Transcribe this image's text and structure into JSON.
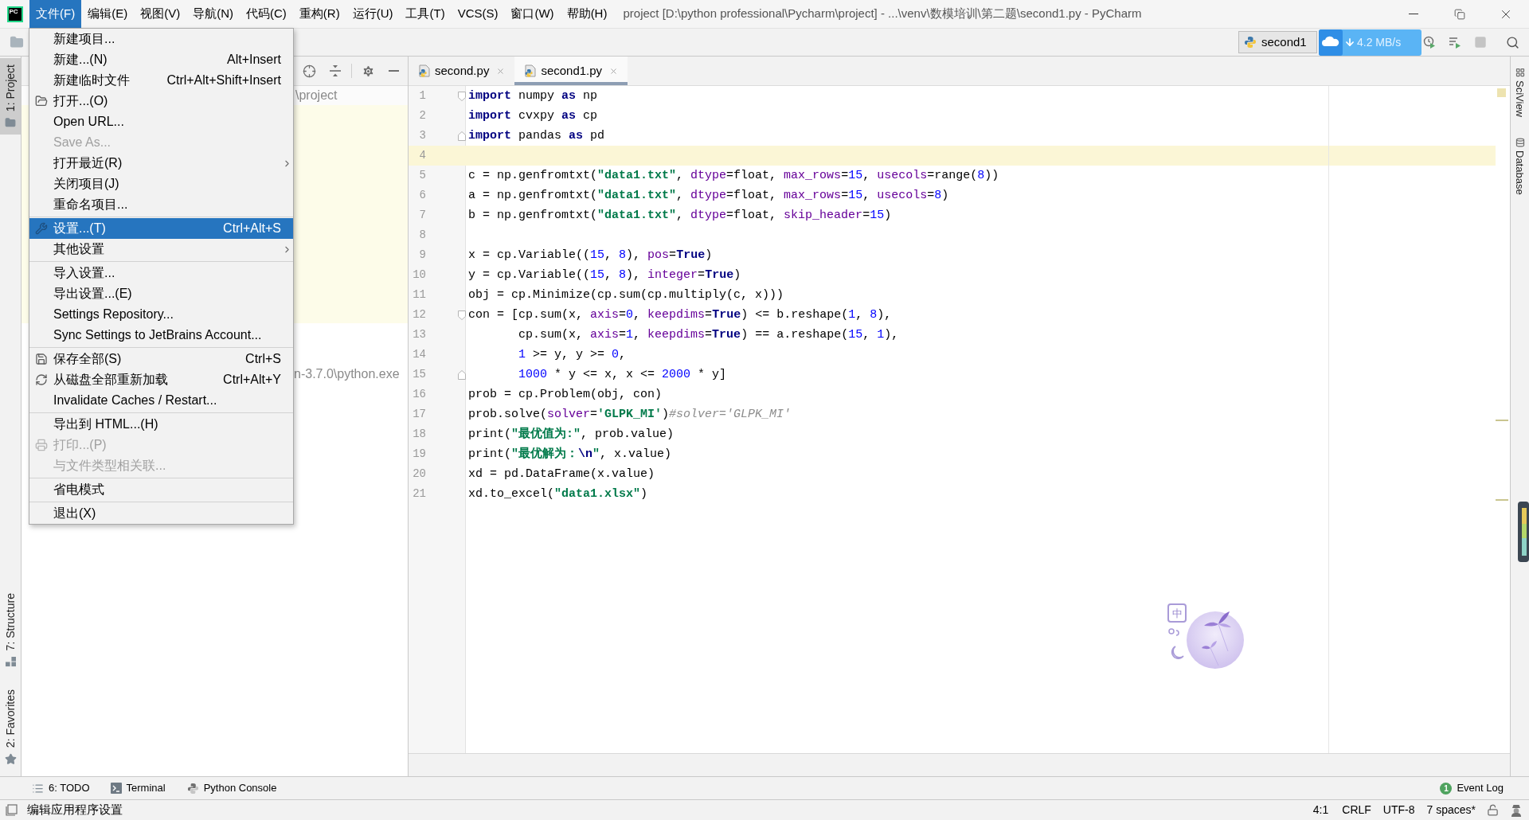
{
  "window": {
    "logo_text": "PC",
    "title": "project [D:\\python professional\\Pycharm\\project] - ...\\venv\\数模培训\\第二题\\second1.py - PyCharm"
  },
  "menu_bar": [
    {
      "label": "文件(F)",
      "selected": true
    },
    {
      "label": "编辑(E)",
      "selected": false
    },
    {
      "label": "视图(V)",
      "selected": false
    },
    {
      "label": "导航(N)",
      "selected": false
    },
    {
      "label": "代码(C)",
      "selected": false
    },
    {
      "label": "重构(R)",
      "selected": false
    },
    {
      "label": "运行(U)",
      "selected": false
    },
    {
      "label": "工具(T)",
      "selected": false
    },
    {
      "label": "VCS(S)",
      "selected": false
    },
    {
      "label": "窗口(W)",
      "selected": false
    },
    {
      "label": "帮助(H)",
      "selected": false
    }
  ],
  "file_menu": {
    "groups": [
      {
        "items": [
          {
            "label": "新建项目...",
            "submenu": false,
            "disabled": false,
            "selected": false
          },
          {
            "label": "新建...(N)",
            "shortcut": "Alt+Insert",
            "submenu": false,
            "disabled": false,
            "selected": false
          },
          {
            "label": "新建临时文件",
            "shortcut": "Ctrl+Alt+Shift+Insert",
            "submenu": false,
            "disabled": false,
            "selected": false
          },
          {
            "label": "打开...(O)",
            "submenu": false,
            "disabled": false,
            "selected": false
          },
          {
            "label": "Open URL...",
            "submenu": false,
            "disabled": false,
            "selected": false
          },
          {
            "label": "Save As...",
            "submenu": false,
            "disabled": true,
            "selected": false
          },
          {
            "label": "打开最近(R)",
            "submenu": true,
            "disabled": false,
            "selected": false
          },
          {
            "label": "关闭项目(J)",
            "submenu": false,
            "disabled": false,
            "selected": false
          },
          {
            "label": "重命名项目...",
            "submenu": false,
            "disabled": false,
            "selected": false
          }
        ]
      },
      {
        "items": [
          {
            "label": "设置...(T)",
            "shortcut": "Ctrl+Alt+S",
            "submenu": false,
            "disabled": false,
            "selected": true
          },
          {
            "label": "其他设置",
            "submenu": true,
            "disabled": false,
            "selected": false
          }
        ]
      },
      {
        "items": [
          {
            "label": "导入设置...",
            "submenu": false,
            "disabled": false,
            "selected": false
          },
          {
            "label": "导出设置...(E)",
            "submenu": false,
            "disabled": false,
            "selected": false
          },
          {
            "label": "Settings Repository...",
            "submenu": false,
            "disabled": false,
            "selected": false
          },
          {
            "label": "Sync Settings to JetBrains Account...",
            "submenu": false,
            "disabled": false,
            "selected": false
          }
        ]
      },
      {
        "items": [
          {
            "label": "保存全部(S)",
            "shortcut": "Ctrl+S",
            "submenu": false,
            "disabled": false,
            "selected": false
          },
          {
            "label": "从磁盘全部重新加载",
            "shortcut": "Ctrl+Alt+Y",
            "submenu": false,
            "disabled": false,
            "selected": false
          },
          {
            "label": "Invalidate Caches / Restart...",
            "submenu": false,
            "disabled": false,
            "selected": false
          }
        ]
      },
      {
        "items": [
          {
            "label": "导出到 HTML...(H)",
            "submenu": false,
            "disabled": false,
            "selected": false
          },
          {
            "label": "打印...(P)",
            "submenu": false,
            "disabled": true,
            "selected": false
          },
          {
            "label": "与文件类型相关联...",
            "submenu": false,
            "disabled": true,
            "selected": false
          }
        ]
      },
      {
        "items": [
          {
            "label": "省电模式",
            "submenu": false,
            "disabled": false,
            "selected": false
          }
        ]
      },
      {
        "items": [
          {
            "label": "退出(X)",
            "submenu": false,
            "disabled": false,
            "selected": false
          }
        ]
      }
    ]
  },
  "toolbar": {
    "run_config": "second1"
  },
  "download_widget": {
    "speed": "4.2 MB/s"
  },
  "left_tool_tabs": [
    {
      "label": "1: Project",
      "selected": true
    },
    {
      "label": "7: Structure",
      "selected": false
    },
    {
      "label": "2: Favorites",
      "selected": false
    }
  ],
  "project_panel": {
    "rows": [
      "\\project",
      "n-3.7.0\\python.exe"
    ]
  },
  "editor_tabs": [
    {
      "label": "second.py",
      "selected": false
    },
    {
      "label": "second1.py",
      "selected": true
    }
  ],
  "editor": {
    "lines": [
      {
        "number": "1",
        "current": false,
        "fold_start": true,
        "fold_end": false,
        "tokens": [
          {
            "kind": "keyword",
            "text": "import"
          },
          {
            "kind": "plain",
            "text": " numpy "
          },
          {
            "kind": "keyword",
            "text": "as"
          },
          {
            "kind": "plain",
            "text": " np"
          }
        ]
      },
      {
        "number": "2",
        "current": false,
        "fold_start": false,
        "fold_end": false,
        "tokens": [
          {
            "kind": "keyword",
            "text": "import"
          },
          {
            "kind": "plain",
            "text": " cvxpy "
          },
          {
            "kind": "keyword",
            "text": "as"
          },
          {
            "kind": "plain",
            "text": " cp"
          }
        ]
      },
      {
        "number": "3",
        "current": false,
        "fold_start": false,
        "fold_end": true,
        "tokens": [
          {
            "kind": "keyword",
            "text": "import"
          },
          {
            "kind": "plain",
            "text": " pandas "
          },
          {
            "kind": "keyword",
            "text": "as"
          },
          {
            "kind": "plain",
            "text": " pd"
          }
        ]
      },
      {
        "number": "4",
        "current": true,
        "fold_start": false,
        "fold_end": false
      },
      {
        "number": "5",
        "current": false,
        "fold_start": false,
        "fold_end": false,
        "tokens": [
          {
            "kind": "plain",
            "text": "c = np.genfromtxt("
          },
          {
            "kind": "string",
            "text": "\"data1.txt\""
          },
          {
            "kind": "plain",
            "text": ", "
          },
          {
            "kind": "kwarg",
            "text": "dtype"
          },
          {
            "kind": "plain",
            "text": "=float, "
          },
          {
            "kind": "kwarg",
            "text": "max_rows"
          },
          {
            "kind": "plain",
            "text": "="
          },
          {
            "kind": "number",
            "text": "15"
          },
          {
            "kind": "plain",
            "text": ", "
          },
          {
            "kind": "kwarg",
            "text": "usecols"
          },
          {
            "kind": "plain",
            "text": "=range("
          },
          {
            "kind": "number",
            "text": "8"
          },
          {
            "kind": "plain",
            "text": "))"
          }
        ]
      },
      {
        "number": "6",
        "current": false,
        "fold_start": false,
        "fold_end": false,
        "tokens": [
          {
            "kind": "plain",
            "text": "a = np.genfromtxt("
          },
          {
            "kind": "string",
            "text": "\"data1.txt\""
          },
          {
            "kind": "plain",
            "text": ", "
          },
          {
            "kind": "kwarg",
            "text": "dtype"
          },
          {
            "kind": "plain",
            "text": "=float, "
          },
          {
            "kind": "kwarg",
            "text": "max_rows"
          },
          {
            "kind": "plain",
            "text": "="
          },
          {
            "kind": "number",
            "text": "15"
          },
          {
            "kind": "plain",
            "text": ", "
          },
          {
            "kind": "kwarg",
            "text": "usecols"
          },
          {
            "kind": "plain",
            "text": "="
          },
          {
            "kind": "number",
            "text": "8"
          },
          {
            "kind": "plain",
            "text": ")"
          }
        ]
      },
      {
        "number": "7",
        "current": false,
        "fold_start": false,
        "fold_end": false,
        "tokens": [
          {
            "kind": "plain",
            "text": "b = np.genfromtxt("
          },
          {
            "kind": "string",
            "text": "\"data1.txt\""
          },
          {
            "kind": "plain",
            "text": ", "
          },
          {
            "kind": "kwarg",
            "text": "dtype"
          },
          {
            "kind": "plain",
            "text": "=float, "
          },
          {
            "kind": "kwarg",
            "text": "skip_header"
          },
          {
            "kind": "plain",
            "text": "="
          },
          {
            "kind": "number",
            "text": "15"
          },
          {
            "kind": "plain",
            "text": ")"
          }
        ]
      },
      {
        "number": "8",
        "current": false,
        "fold_start": false,
        "fold_end": false
      },
      {
        "number": "9",
        "current": false,
        "fold_start": false,
        "fold_end": false,
        "tokens": [
          {
            "kind": "plain",
            "text": "x = cp.Variable(("
          },
          {
            "kind": "number",
            "text": "15"
          },
          {
            "kind": "plain",
            "text": ", "
          },
          {
            "kind": "number",
            "text": "8"
          },
          {
            "kind": "plain",
            "text": "), "
          },
          {
            "kind": "kwarg",
            "text": "pos"
          },
          {
            "kind": "plain",
            "text": "="
          },
          {
            "kind": "keyword",
            "text": "True"
          },
          {
            "kind": "plain",
            "text": ")"
          }
        ]
      },
      {
        "number": "10",
        "current": false,
        "fold_start": false,
        "fold_end": false,
        "tokens": [
          {
            "kind": "plain",
            "text": "y = cp.Variable(("
          },
          {
            "kind": "number",
            "text": "15"
          },
          {
            "kind": "plain",
            "text": ", "
          },
          {
            "kind": "number",
            "text": "8"
          },
          {
            "kind": "plain",
            "text": "), "
          },
          {
            "kind": "kwarg",
            "text": "integer"
          },
          {
            "kind": "plain",
            "text": "="
          },
          {
            "kind": "keyword",
            "text": "True"
          },
          {
            "kind": "plain",
            "text": ")"
          }
        ]
      },
      {
        "number": "11",
        "current": false,
        "fold_start": false,
        "fold_end": false,
        "tokens": [
          {
            "kind": "plain",
            "text": "obj = cp.Minimize(cp.sum(cp.multiply(c, x)))"
          }
        ]
      },
      {
        "number": "12",
        "current": false,
        "fold_start": true,
        "fold_end": false,
        "tokens": [
          {
            "kind": "plain",
            "text": "con = [cp.sum(x, "
          },
          {
            "kind": "kwarg",
            "text": "axis"
          },
          {
            "kind": "plain",
            "text": "="
          },
          {
            "kind": "number",
            "text": "0"
          },
          {
            "kind": "plain",
            "text": ", "
          },
          {
            "kind": "kwarg",
            "text": "keepdims"
          },
          {
            "kind": "plain",
            "text": "="
          },
          {
            "kind": "keyword",
            "text": "True"
          },
          {
            "kind": "plain",
            "text": ") <= b.reshape("
          },
          {
            "kind": "number",
            "text": "1"
          },
          {
            "kind": "plain",
            "text": ", "
          },
          {
            "kind": "number",
            "text": "8"
          },
          {
            "kind": "plain",
            "text": "),"
          }
        ],
        "children": [
          {
            "number": "13",
            "current": false,
            "fold_start": false,
            "fold_end": false,
            "tokens": [
              {
                "kind": "plain",
                "text": "cp.sum(x, "
              },
              {
                "kind": "kwarg",
                "text": "axis"
              },
              {
                "kind": "plain",
                "text": "="
              },
              {
                "kind": "number",
                "text": "1"
              },
              {
                "kind": "plain",
                "text": ", "
              },
              {
                "kind": "kwarg",
                "text": "keepdims"
              },
              {
                "kind": "plain",
                "text": "="
              },
              {
                "kind": "keyword",
                "text": "True"
              },
              {
                "kind": "plain",
                "text": ") == a.reshape("
              },
              {
                "kind": "number",
                "text": "15"
              },
              {
                "kind": "plain",
                "text": ", "
              },
              {
                "kind": "number",
                "text": "1"
              },
              {
                "kind": "plain",
                "text": "),"
              }
            ]
          },
          {
            "number": "14",
            "current": false,
            "fold_start": false,
            "fold_end": false,
            "tokens": [
              {
                "kind": "number",
                "text": "1"
              },
              {
                "kind": "plain",
                "text": " >= y, y >= "
              },
              {
                "kind": "number",
                "text": "0"
              },
              {
                "kind": "plain",
                "text": ","
              }
            ]
          },
          {
            "number": "15",
            "current": false,
            "fold_start": false,
            "fold_end": true,
            "tokens": [
              {
                "kind": "number",
                "text": "1000"
              },
              {
                "kind": "plain",
                "text": " * y <= x, x <= "
              },
              {
                "kind": "number",
                "text": "2000"
              },
              {
                "kind": "plain",
                "text": " * y]"
              }
            ]
          }
        ]
      },
      {
        "number": "16",
        "current": false,
        "fold_start": false,
        "fold_end": false,
        "tokens": [
          {
            "kind": "plain",
            "text": "prob = cp.Problem(obj, con)"
          }
        ]
      },
      {
        "number": "17",
        "current": false,
        "fold_start": false,
        "fold_end": false,
        "tokens": [
          {
            "kind": "plain",
            "text": "prob.solve("
          },
          {
            "kind": "kwarg",
            "text": "solver"
          },
          {
            "kind": "plain",
            "text": "="
          },
          {
            "kind": "string",
            "text": "'GLPK_MI'"
          },
          {
            "kind": "plain",
            "text": ")"
          },
          {
            "kind": "comment",
            "text": "#solver='GLPK_MI'"
          }
        ]
      },
      {
        "number": "18",
        "current": false,
        "fold_start": false,
        "fold_end": false,
        "tokens": [
          {
            "kind": "plain",
            "text": "print("
          },
          {
            "kind": "string",
            "text": "\"最优值为:\""
          },
          {
            "kind": "plain",
            "text": ", prob.value)"
          }
        ]
      },
      {
        "number": "19",
        "current": false,
        "fold_start": false,
        "fold_end": false,
        "tokens": [
          {
            "kind": "plain",
            "text": "print("
          },
          {
            "kind": "string",
            "text": "\"最优解为："
          },
          {
            "kind": "escape",
            "text": "\\n"
          },
          {
            "kind": "string",
            "text": "\""
          },
          {
            "kind": "plain",
            "text": ", x.value)"
          }
        ]
      },
      {
        "number": "20",
        "current": false,
        "fold_start": false,
        "fold_end": false,
        "tokens": [
          {
            "kind": "plain",
            "text": "xd = pd.DataFrame(x.value)"
          }
        ]
      },
      {
        "number": "21",
        "current": false,
        "fold_start": false,
        "fold_end": false,
        "tokens": [
          {
            "kind": "plain",
            "text": "xd.to_excel("
          },
          {
            "kind": "string",
            "text": "\"data1.xlsx\""
          },
          {
            "kind": "plain",
            "text": ")"
          }
        ]
      }
    ]
  },
  "right_tool_tabs": [
    {
      "label": "SciView"
    },
    {
      "label": "Database"
    }
  ],
  "ime_widget": {
    "label": "中"
  },
  "bottom_tool_tabs": [
    {
      "label": "6: TODO"
    },
    {
      "label": "Terminal"
    },
    {
      "label": "Python Console"
    }
  ],
  "event_log": {
    "count": "1",
    "label": "Event Log"
  },
  "status_bar": {
    "message": "编辑应用程序设置",
    "position": "4:1",
    "line_separator": "CRLF",
    "encoding": "UTF-8",
    "indent": "7 spaces*"
  }
}
